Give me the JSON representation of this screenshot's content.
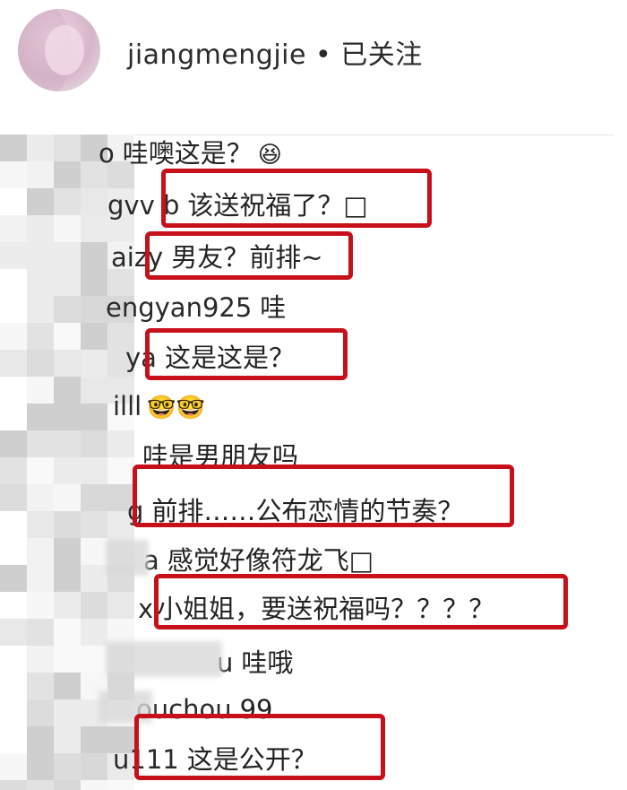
{
  "header": {
    "username_line": "jiangmengjie • 已关注"
  },
  "comments": [
    {
      "username": "o",
      "text": "哇噢这是？",
      "emoji": "😆"
    },
    {
      "username": "gvv b",
      "text": "该送祝福了？□",
      "emoji": ""
    },
    {
      "username": "aizy",
      "text": "男友？前排~",
      "emoji": ""
    },
    {
      "username": "engyan925",
      "text": "哇",
      "emoji": ""
    },
    {
      "username": "ya",
      "text": "这是这是？",
      "emoji": ""
    },
    {
      "username": "illl",
      "text": "",
      "emoji": "🤓🤓"
    },
    {
      "username": "",
      "text": "哇是男朋友吗",
      "emoji": ""
    },
    {
      "username": "g",
      "text": "前排……公布恋情的节奏？",
      "emoji": ""
    },
    {
      "username": "a",
      "text": "感觉好像符龙飞□",
      "emoji": ""
    },
    {
      "username": "x",
      "text": "小姐姐，要送祝福吗？？？？",
      "emoji": ""
    },
    {
      "username": "u",
      "text": "哇哦",
      "emoji": ""
    },
    {
      "username": "ouchou",
      "text": "99",
      "emoji": ""
    },
    {
      "username": "u111",
      "text": "这是公开？",
      "emoji": ""
    }
  ],
  "colors": {
    "highlight": "#c8101a",
    "text": "#232323",
    "divider": "#e6e6e6"
  }
}
